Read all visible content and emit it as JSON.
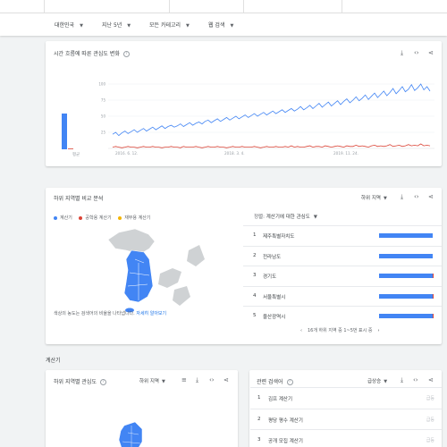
{
  "filters": {
    "region": "대한민국",
    "period": "지난 5년",
    "category": "모든 카테고리",
    "search_type": "웹 검색"
  },
  "interest_over_time": {
    "title": "시간 흐름에 따른 관심도 변화",
    "average_label": "평균",
    "average_values": [
      100,
      2
    ],
    "x_tick_labels": [
      "2016. 6. 12.",
      "2018. 3. 4.",
      "2019. 11. 24."
    ],
    "y_tick_labels": [
      "100",
      "75",
      "50",
      "25"
    ]
  },
  "chart_data": {
    "type": "line",
    "title": "",
    "xlabel": "",
    "ylabel": "",
    "ylim": [
      0,
      100
    ],
    "x_ticks": [
      "2016. 6. 12.",
      "2018. 3. 4.",
      "2019. 11. 24."
    ],
    "y_ticks": [
      25,
      50,
      75,
      100
    ],
    "series": [
      {
        "color": "#4285f4",
        "values": [
          22,
          25,
          20,
          24,
          27,
          23,
          26,
          29,
          25,
          28,
          31,
          27,
          30,
          33,
          29,
          32,
          35,
          31,
          34,
          36,
          33,
          35,
          38,
          34,
          37,
          40,
          36,
          39,
          41,
          38,
          42,
          44,
          40,
          43,
          46,
          42,
          45,
          48,
          44,
          47,
          50,
          46,
          49,
          52,
          48,
          51,
          54,
          50,
          53,
          56,
          52,
          55,
          58,
          54,
          57,
          60,
          56,
          59,
          62,
          58,
          61,
          65,
          60,
          63,
          67,
          62,
          66,
          70,
          64,
          68,
          72,
          66,
          70,
          74,
          68,
          73,
          77,
          71,
          75,
          80,
          74,
          78,
          83,
          76,
          81,
          86,
          79,
          84,
          89,
          82,
          87,
          93,
          85,
          90,
          96,
          88,
          92,
          99,
          90,
          94,
          100,
          91,
          96,
          89
        ]
      },
      {
        "color": "#db4437",
        "values": [
          2,
          3,
          2,
          1,
          2,
          3,
          2,
          2,
          1,
          2,
          3,
          2,
          2,
          3,
          2,
          2,
          1,
          2,
          2,
          3,
          2,
          2,
          1,
          3,
          2,
          2,
          2,
          3,
          2,
          1,
          2,
          3,
          2,
          2,
          3,
          2,
          2,
          1,
          2,
          3,
          2,
          2,
          3,
          2,
          2,
          2,
          3,
          2,
          1,
          2,
          3,
          2,
          2,
          3,
          2,
          2,
          3,
          2,
          4,
          2,
          3,
          2,
          2,
          3,
          4,
          2,
          3,
          3,
          2,
          4,
          3,
          2,
          3,
          4,
          3,
          2,
          4,
          3,
          3,
          5,
          3,
          4,
          3,
          2,
          4,
          5,
          3,
          4,
          3,
          4,
          6,
          3,
          4,
          5,
          3,
          4,
          6,
          4,
          5,
          4,
          7,
          4,
          5,
          4
        ]
      }
    ]
  },
  "subregion_compare": {
    "title": "하위 지역별 비교 분석",
    "dropdown": "하위 지역",
    "legend": [
      {
        "label": "계산기",
        "color": "#4285f4"
      },
      {
        "label": "공학용 계산기",
        "color": "#db4437"
      },
      {
        "label": "재무용 계산기",
        "color": "#f4b400"
      }
    ],
    "sort_label": "정렬:",
    "sort_value": "계산기에 대한 관심도",
    "note": "색상의 농도는 검색어의 비율을 나타냅니다.",
    "note_link": "자세히 알아보기",
    "rows": [
      {
        "rank": "1",
        "name": "제주특별자치도",
        "blue": 1.0,
        "red": 0.0
      },
      {
        "rank": "2",
        "name": "전라남도",
        "blue": 1.0,
        "red": 0.0
      },
      {
        "rank": "3",
        "name": "경기도",
        "blue": 1.0,
        "red": 0.03
      },
      {
        "rank": "4",
        "name": "서울특별시",
        "blue": 1.0,
        "red": 0.04
      },
      {
        "rank": "5",
        "name": "울산광역시",
        "blue": 1.0,
        "red": 0.03
      }
    ],
    "pagination": "16개 하위 지역 중 1~5번 표시 중"
  },
  "section_label": "계산기",
  "subregion_interest": {
    "title": "하위 지역별 관심도",
    "dropdown": "하위 지역"
  },
  "related_queries": {
    "title": "관련 검색어",
    "dropdown": "급상승",
    "rows": [
      {
        "rank": "1",
        "name": "김프 계산기",
        "value": "급등"
      },
      {
        "rank": "2",
        "name": "평당 평수 계산기",
        "value": "급등"
      },
      {
        "rank": "3",
        "name": "공개 모집 계산기",
        "value": "급등"
      }
    ]
  },
  "icons": {
    "download": "download-icon",
    "embed": "embed-icon",
    "share": "share-icon",
    "help": "help-icon",
    "list": "list-icon"
  }
}
